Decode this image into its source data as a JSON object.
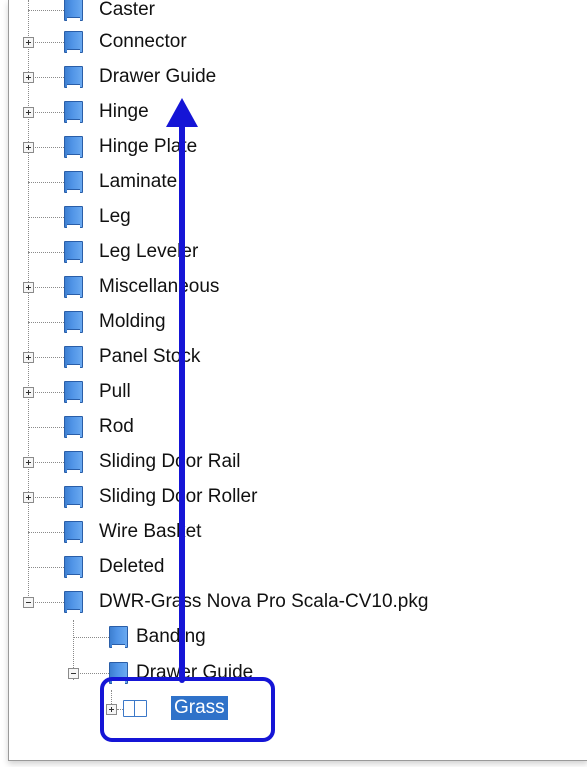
{
  "tree": {
    "items": [
      {
        "label": "Caster",
        "expander": "none"
      },
      {
        "label": "Connector",
        "expander": "plus"
      },
      {
        "label": "Drawer Guide",
        "expander": "plus"
      },
      {
        "label": "Hinge",
        "expander": "plus"
      },
      {
        "label": "Hinge Plate",
        "expander": "plus"
      },
      {
        "label": "Laminate",
        "expander": "none"
      },
      {
        "label": "Leg",
        "expander": "none"
      },
      {
        "label": "Leg Leveler",
        "expander": "none"
      },
      {
        "label": "Miscellaneous",
        "expander": "plus"
      },
      {
        "label": "Molding",
        "expander": "none"
      },
      {
        "label": "Panel Stock",
        "expander": "plus"
      },
      {
        "label": "Pull",
        "expander": "plus"
      },
      {
        "label": "Rod",
        "expander": "none"
      },
      {
        "label": "Sliding Door Rail",
        "expander": "plus"
      },
      {
        "label": "Sliding Door Roller",
        "expander": "plus"
      },
      {
        "label": "Wire Basket",
        "expander": "none"
      },
      {
        "label": "Deleted",
        "expander": "none"
      },
      {
        "label": "DWR-Grass Nova Pro Scala-CV10.pkg",
        "expander": "minus"
      }
    ],
    "package_children": [
      {
        "label": "Banding",
        "expander": "none"
      },
      {
        "label": "Drawer Guide",
        "expander": "minus"
      }
    ],
    "selected_item": {
      "label": "Grass",
      "expander": "plus"
    }
  },
  "colors": {
    "annotation": "#1515d6",
    "selection": "#2f72c9",
    "icon": "#4f93e6"
  }
}
